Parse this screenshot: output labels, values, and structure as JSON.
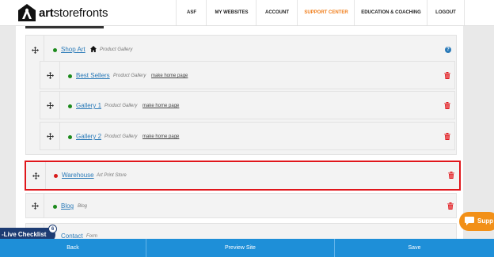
{
  "header": {
    "logo_text_bold": "art",
    "logo_text_rest": "storefronts",
    "nav": [
      {
        "label": "ASF",
        "active": false
      },
      {
        "label": "MY WEBSITES",
        "active": false
      },
      {
        "label": "ACCOUNT",
        "active": false
      },
      {
        "label": "SUPPORT CENTER",
        "active": true
      },
      {
        "label": "EDUCATION & COACHING",
        "active": false
      },
      {
        "label": "LOGOUT",
        "active": false
      }
    ]
  },
  "pages": {
    "shop_art": {
      "name": "Shop Art",
      "type": "Product Gallery"
    },
    "best_sellers": {
      "name": "Best Sellers",
      "type": "Product Gallery",
      "action": "make home page"
    },
    "gallery_1": {
      "name": "Gallery 1",
      "type": "Product Gallery",
      "action": "make home page"
    },
    "gallery_2": {
      "name": "Gallery 2",
      "type": "Product Gallery",
      "action": "make home page"
    },
    "warehouse": {
      "name": "Warehouse",
      "type": "Art Print Store"
    },
    "blog": {
      "name": "Blog",
      "type": "Blog"
    },
    "contact": {
      "name": "Contact",
      "type": "Form"
    }
  },
  "checklist": {
    "label": "-Live Checklist",
    "count": "6"
  },
  "support": {
    "label": "Supp"
  },
  "footer": {
    "back": "Back",
    "preview": "Preview Site",
    "save": "Save"
  },
  "colors": {
    "accent": "#f07d1a",
    "footer": "#1e8fd8",
    "link": "#2a7ab8",
    "highlight": "#e0161b",
    "published": "#1c8a1c",
    "unpublished": "#d81b1b"
  }
}
